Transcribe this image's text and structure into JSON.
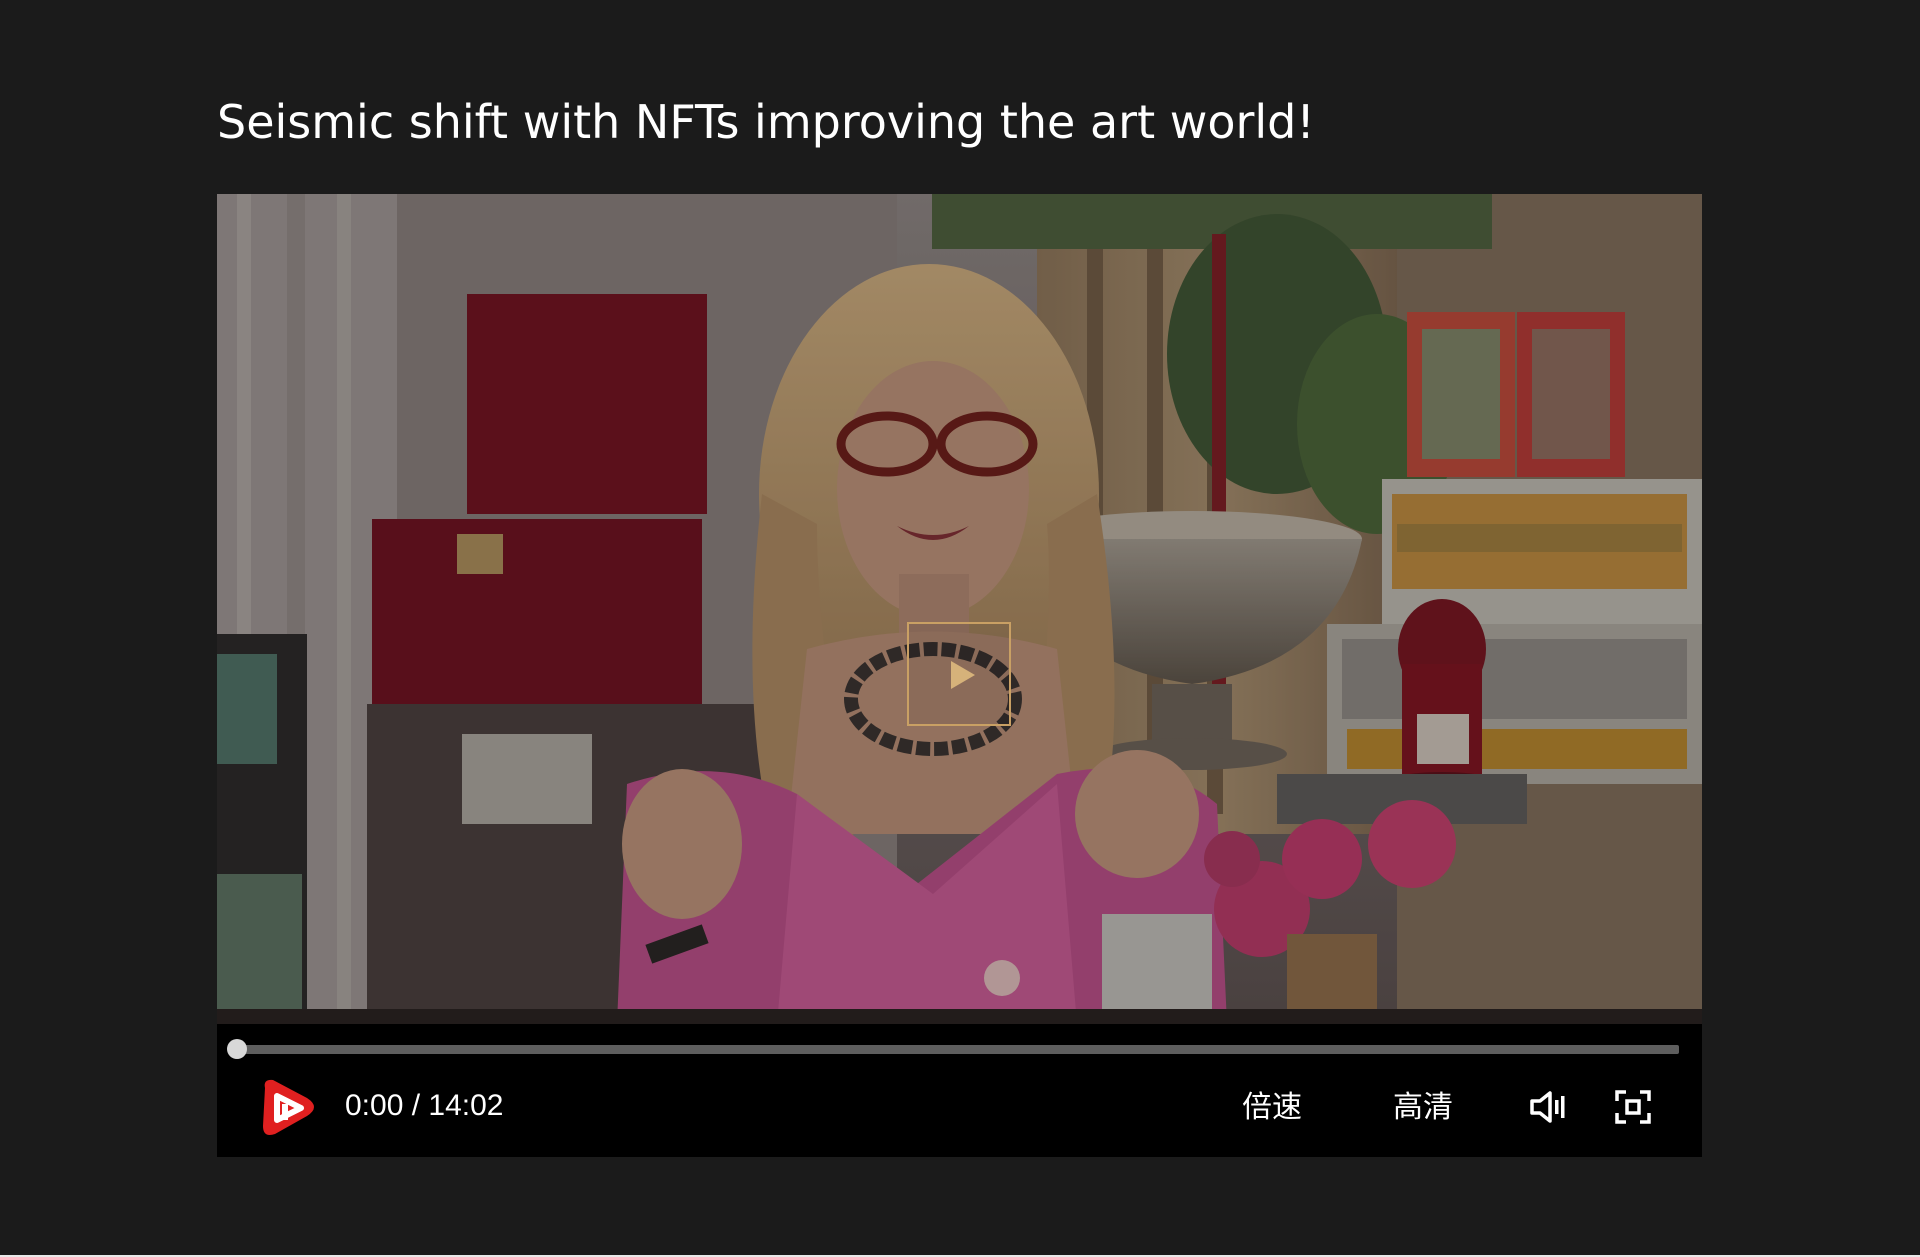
{
  "page": {
    "title": "Seismic shift with NFTs improving the art world!"
  },
  "player": {
    "current_time": "0:00",
    "duration": "14:02",
    "time_display": "0:00 / 14:02",
    "progress_fraction": 0,
    "controls": {
      "speed_label": "倍速",
      "quality_label": "高清"
    },
    "icons": {
      "big_play": "play-icon",
      "play": "play-logo-icon",
      "volume": "volume-icon",
      "fullscreen": "fullscreen-icon"
    },
    "colors": {
      "play_logo": "#e02020",
      "big_play_border": "#c9a064",
      "progress_track": "#5e5e5e",
      "background": "#1b1b1b"
    }
  }
}
